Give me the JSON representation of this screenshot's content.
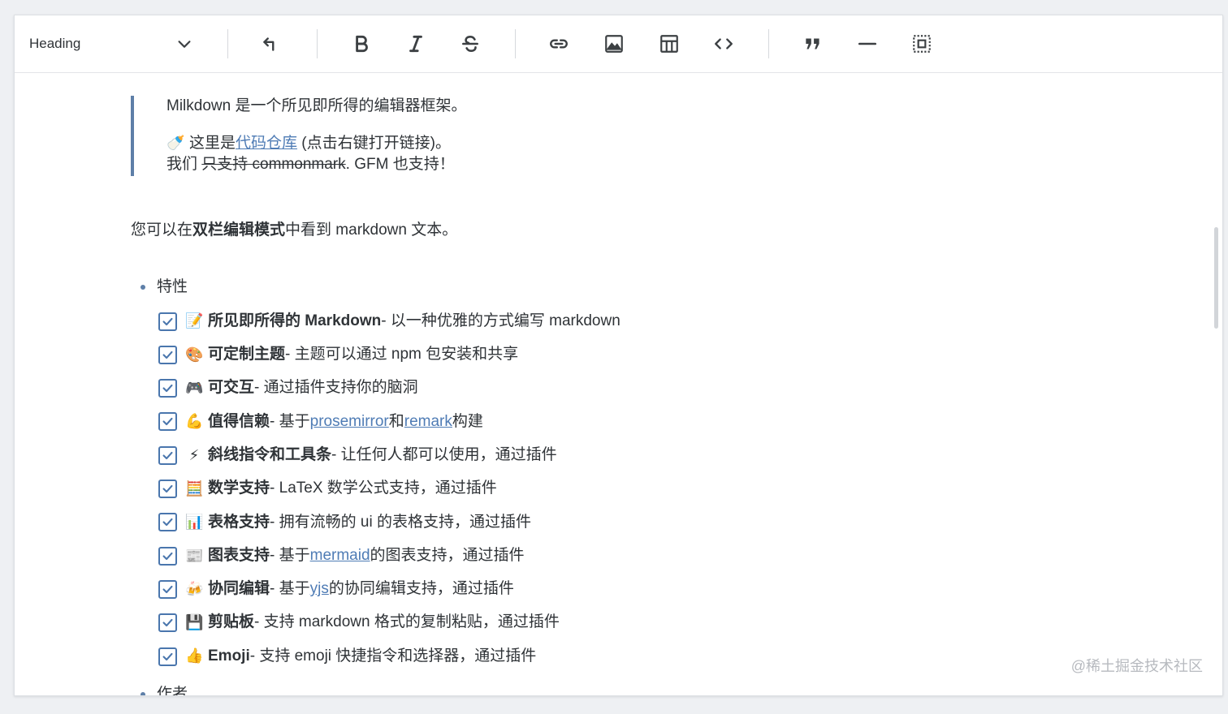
{
  "toolbar": {
    "heading_label": "Heading",
    "buttons": [
      "undo-icon",
      "bold-icon",
      "italic-icon",
      "strikethrough-icon",
      "link-icon",
      "image-icon",
      "table-icon",
      "code-icon",
      "quote-icon",
      "divider-icon",
      "select-all-icon"
    ]
  },
  "blockquote": {
    "line1": "Milkdown 是一个所见即所得的编辑器框架。",
    "line2_emoji": "🍼",
    "line2_prefix": "这里是",
    "line2_link": "代码仓库",
    "line2_suffix": " (点击右键打开链接)。",
    "line3_prefix": "我们 ",
    "line3_strike": "只支持 commonmark",
    "line3_suffix": ". GFM 也支持！"
  },
  "para": {
    "prefix": "您可以在",
    "bold": "双栏编辑模式",
    "suffix": "中看到 markdown 文本。"
  },
  "features": {
    "title": "特性",
    "next_title": "作者",
    "items": [
      {
        "emoji": "📝",
        "bold": "所见即所得的 Markdown",
        "pre": " - 以一种优雅的方式编写 markdown",
        "link": "",
        "post": "",
        "link2": "",
        "post2": ""
      },
      {
        "emoji": "🎨",
        "bold": "可定制主题",
        "pre": " - 主题可以通过 npm 包安装和共享",
        "link": "",
        "post": "",
        "link2": "",
        "post2": ""
      },
      {
        "emoji": "🎮",
        "bold": "可交互",
        "pre": " - 通过插件支持你的脑洞",
        "link": "",
        "post": "",
        "link2": "",
        "post2": ""
      },
      {
        "emoji": "💪",
        "bold": "值得信赖",
        "pre": " - 基于",
        "link": "prosemirror",
        "post": " 和 ",
        "link2": "remark",
        "post2": "构建"
      },
      {
        "emoji": "⚡",
        "bold": "斜线指令和工具条",
        "pre": " - 让任何人都可以使用，通过插件",
        "link": "",
        "post": "",
        "link2": "",
        "post2": ""
      },
      {
        "emoji": "🧮",
        "bold": "数学支持",
        "pre": " - LaTeX 数学公式支持，通过插件",
        "link": "",
        "post": "",
        "link2": "",
        "post2": ""
      },
      {
        "emoji": "📊",
        "bold": "表格支持",
        "pre": " - 拥有流畅的 ui 的表格支持，通过插件",
        "link": "",
        "post": "",
        "link2": "",
        "post2": ""
      },
      {
        "emoji": "📰",
        "bold": "图表支持",
        "pre": " - 基于",
        "link": "mermaid",
        "post": "的图表支持，通过插件",
        "link2": "",
        "post2": ""
      },
      {
        "emoji": "🍻",
        "bold": "协同编辑",
        "pre": " - 基于",
        "link": "yjs",
        "post": "的协同编辑支持，通过插件",
        "link2": "",
        "post2": ""
      },
      {
        "emoji": "💾",
        "bold": "剪贴板",
        "pre": " - 支持 markdown 格式的复制粘贴，通过插件",
        "link": "",
        "post": "",
        "link2": "",
        "post2": ""
      },
      {
        "emoji": "👍",
        "bold": "Emoji",
        "pre": " - 支持 emoji 快捷指令和选择器，通过插件",
        "link": "",
        "post": "",
        "link2": "",
        "post2": ""
      }
    ]
  },
  "watermark": "@稀土掘金技术社区",
  "colors": {
    "accent": "#5e7fa8",
    "link": "#4f7cb5",
    "checkbox": "#4a76ad"
  }
}
